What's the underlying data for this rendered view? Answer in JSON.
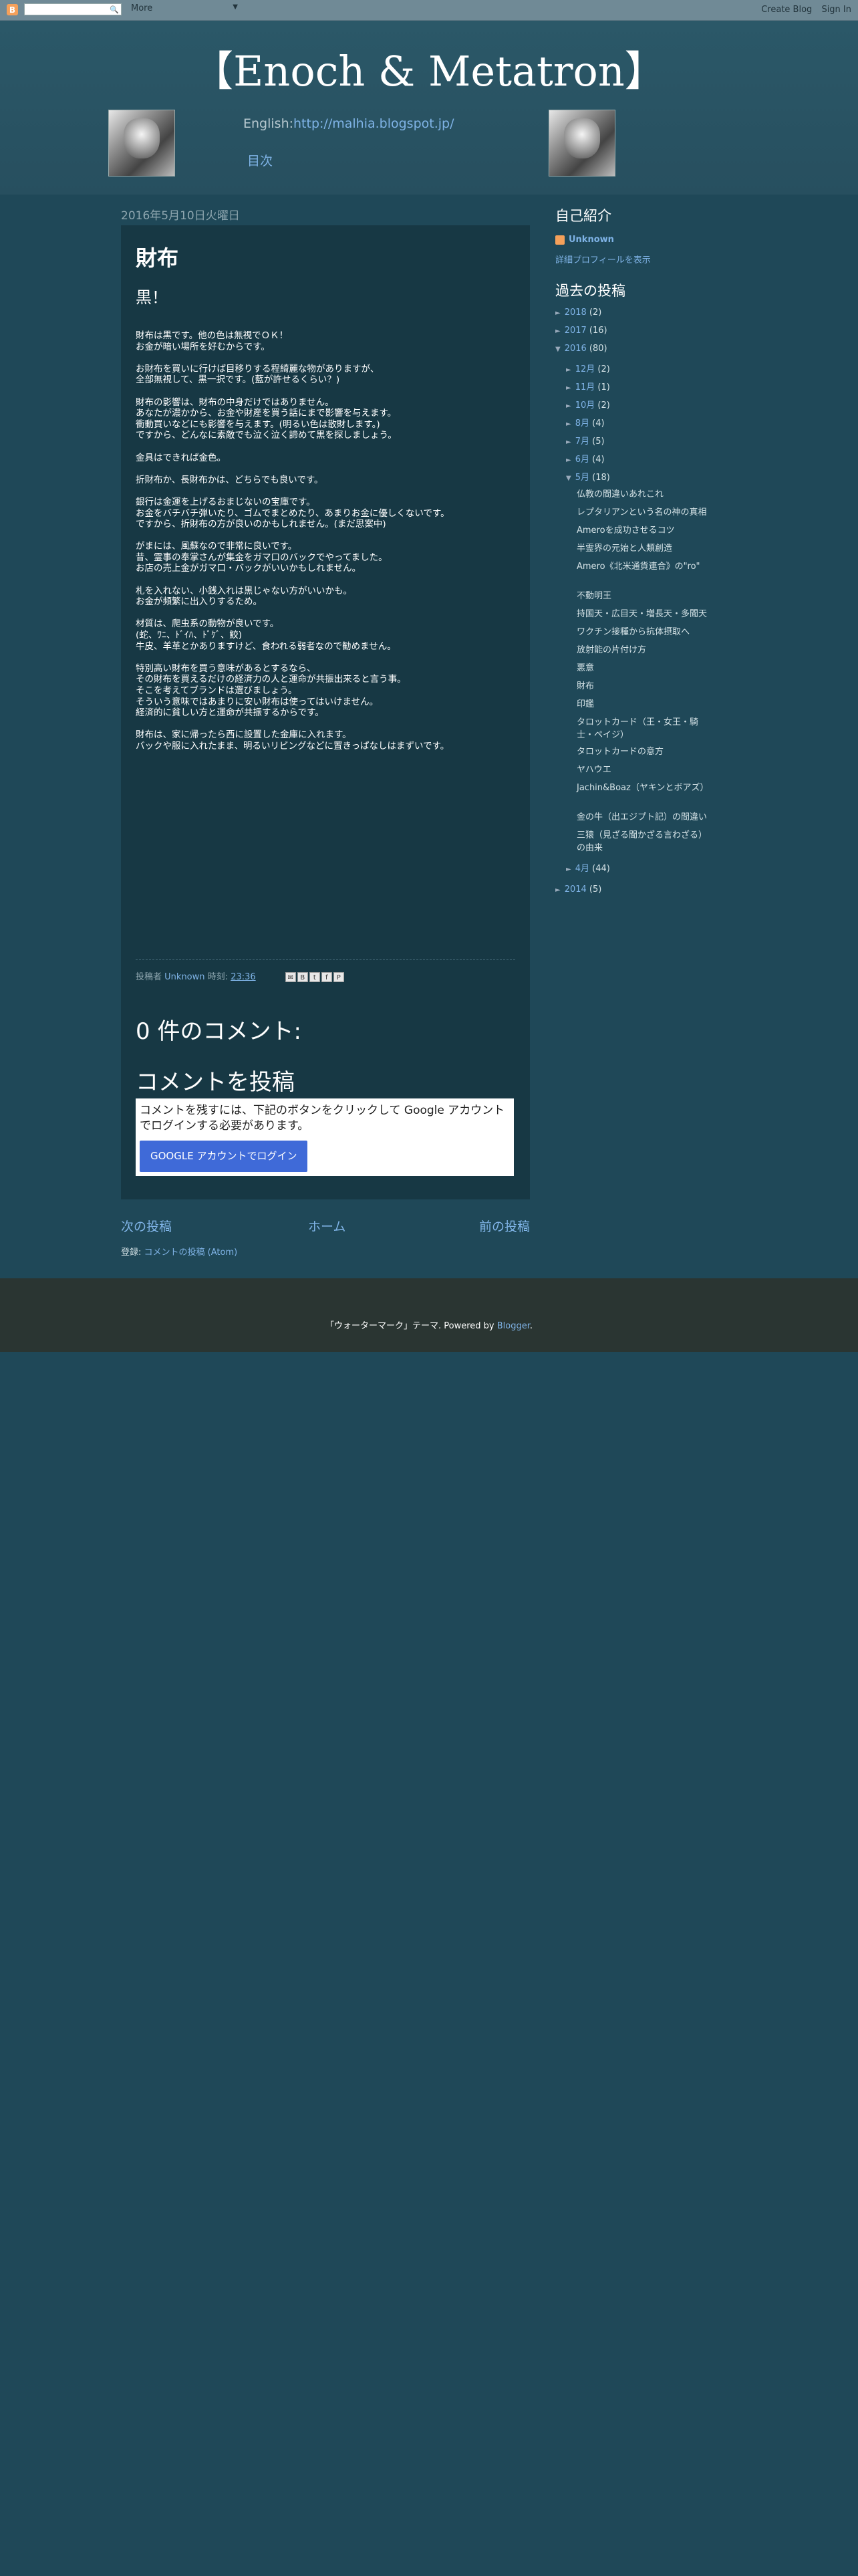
{
  "navbar": {
    "more_label": "More",
    "create_blog": "Create Blog",
    "sign_in": "Sign In"
  },
  "blog": {
    "title": "【Enoch & Metatron】",
    "english_label": "English:",
    "english_url": "http://malhia.blogspot.jp/",
    "toc_label": "目次"
  },
  "post": {
    "date": "2016年5月10日火曜日",
    "title": "財布",
    "subtitle": "黒！",
    "paragraphs": [
      [
        "財布は黒です。他の色は無視でＯＫ！",
        "お金が暗い場所を好むからです。"
      ],
      [
        "お財布を買いに行けば目移りする程綺麗な物がありますが、",
        "全部無視して、黒一択です。(藍が許せるくらい？)"
      ],
      [
        "財布の影響は、財布の中身だけではありません。",
        "あなたが濃かから、お金や財産を買う話にまで影響を与えます。",
        "衝動買いなどにも影響を与えます。(明るい色は散財します。)",
        "ですから、どんなに素敵でも泣く泣く諦めて黒を探しましょう。"
      ],
      [
        "金具はできれば金色。"
      ],
      [
        "折財布か、長財布かは、どちらでも良いです。"
      ],
      [
        "銀行は金運を上げるおまじないの宝庫です。",
        "お金をバチバチ弾いたり、ゴムでまとめたり、あまりお金に優しくないです。",
        "ですから、折財布の方が良いのかもしれません。(まだ思案中)"
      ],
      [
        "がまには、風蘇なので非常に良いです。",
        "昔、霊事の奉掌さんが集金をガマ口のバックでやってました。",
        "お店の売上金がガマ口・バックがいいかもしれません。"
      ],
      [
        "札を入れない、小銭入れは黒じゃない方がいいかも。",
        "お金が頻繁に出入りするため。"
      ],
      [
        "材質は、爬虫系の動物が良いです。",
        "(蛇、ﾜﾆ、ﾄﾞｲﾊ、ﾄﾞｹﾞ、鮫)",
        "牛皮、羊革とかありますけど、食われる弱者なので勧めません。"
      ],
      [
        "特別高い財布を買う意味があるとするなら、",
        "その財布を買えるだけの経済力の人と運命が共振出来ると言う事。",
        "そこを考えてブランドは選びましょう。",
        "そういう意味ではあまりに安い財布は使ってはいけません。",
        "経済的に貧しい方と運命が共振するからです。"
      ],
      [
        "財布は、家に帰ったら西に設置した金庫に入れます。",
        "バックや服に入れたまま、明るいリビングなどに置きっぱなしはまずいです。"
      ]
    ],
    "footer_posted_by": "投稿者",
    "footer_author": "Unknown",
    "footer_time_label": "時刻:",
    "footer_time": "23:36",
    "comments_heading": "0 件のコメント:",
    "post_comment_heading": "コメントを投稿",
    "comment_notice": "コメントを残すには、下記のボタンをクリックして Google アカウントでログインする必要があります。",
    "google_login_label": "GOOGLE アカウントでログイン"
  },
  "pager": {
    "newer": "次の投稿",
    "home": "ホーム",
    "older": "前の投稿"
  },
  "subscribe": {
    "label": "登録:",
    "link": "コメントの投稿 (Atom)"
  },
  "sidebar": {
    "profile_heading": "自己紹介",
    "profile_name": "Unknown",
    "profile_link": "詳細プロフィールを表示",
    "archive_heading": "過去の投稿",
    "archive": [
      {
        "label": "2018",
        "count": "(2)",
        "tri": "►",
        "level": 0
      },
      {
        "label": "2017",
        "count": "(16)",
        "tri": "►",
        "level": 0
      },
      {
        "label": "2016",
        "count": "(80)",
        "tri": "▼",
        "level": 0
      },
      {
        "label": "12月",
        "count": "(2)",
        "tri": "►",
        "level": 1
      },
      {
        "label": "11月",
        "count": "(1)",
        "tri": "►",
        "level": 1
      },
      {
        "label": "10月",
        "count": "(2)",
        "tri": "►",
        "level": 1
      },
      {
        "label": "8月",
        "count": "(4)",
        "tri": "►",
        "level": 1
      },
      {
        "label": "7月",
        "count": "(5)",
        "tri": "►",
        "level": 1
      },
      {
        "label": "6月",
        "count": "(4)",
        "tri": "►",
        "level": 1
      },
      {
        "label": "5月",
        "count": "(18)",
        "tri": "▼",
        "level": 1
      }
    ],
    "may_posts": [
      "仏教の間違いあれこれ",
      "レプタリアンという名の神の真相",
      "Ameroを成功させるコツ",
      "半霊界の元始と人類創造",
      "Amero《北米通貨連合》の\"ro\"",
      "不動明王",
      "持国天・広目天・増長天・多聞天",
      "ワクチン接種から抗体摂取へ",
      "放射能の片付け方",
      "悪意",
      "財布",
      "印鑑",
      "タロットカード（王・女王・騎士・ペイジ）",
      "タロットカードの意方",
      "ヤハウエ",
      "Jachin&Boaz（ヤキンとボアズ）",
      "金の牛（出エジプト記）の間違い",
      "三猿（見ざる聞かざる言わざる）の由来"
    ],
    "after": [
      {
        "label": "4月",
        "count": "(44)",
        "tri": "►",
        "level": 1
      },
      {
        "label": "2014",
        "count": "(5)",
        "tri": "►",
        "level": 0
      }
    ]
  },
  "footer": {
    "theme_text": "「ウォーターマーク」テーマ. Powered by",
    "blogger_link": "Blogger"
  },
  "colors": {
    "background": "#1f4858",
    "post_background": "#173844",
    "link": "#7fb3e6",
    "footer": "#2a3532"
  }
}
